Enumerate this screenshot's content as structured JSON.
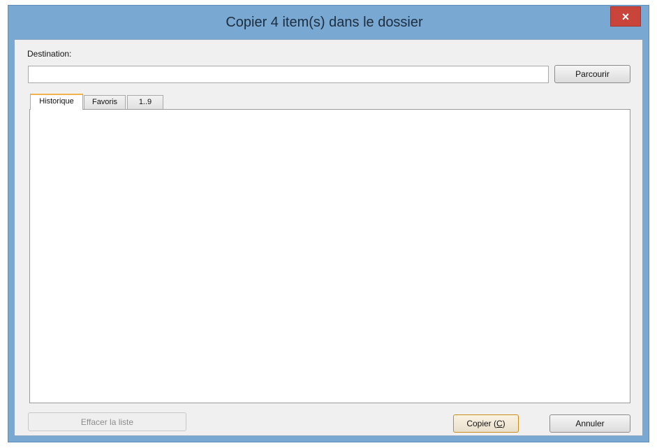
{
  "window": {
    "title": "Copier 4 item(s) dans le dossier",
    "close_glyph": "×"
  },
  "destination": {
    "label": "Destination:",
    "value": "",
    "browse_label": "Parcourir"
  },
  "tabs": [
    {
      "label": "Historique",
      "active": true
    },
    {
      "label": "Favoris",
      "active": false
    },
    {
      "label": "1..9",
      "active": false
    }
  ],
  "list": {
    "items": []
  },
  "footer": {
    "clear_label": "Effacer la liste",
    "clear_enabled": false,
    "copy_label_prefix": "Copier (",
    "copy_accel": "C",
    "copy_label_suffix": ")",
    "cancel_label": "Annuler"
  },
  "colors": {
    "frame": "#79a8d2",
    "close_button": "#c9443a",
    "active_tab_accent": "#f0b34b",
    "default_button_border": "#c88a1b"
  }
}
